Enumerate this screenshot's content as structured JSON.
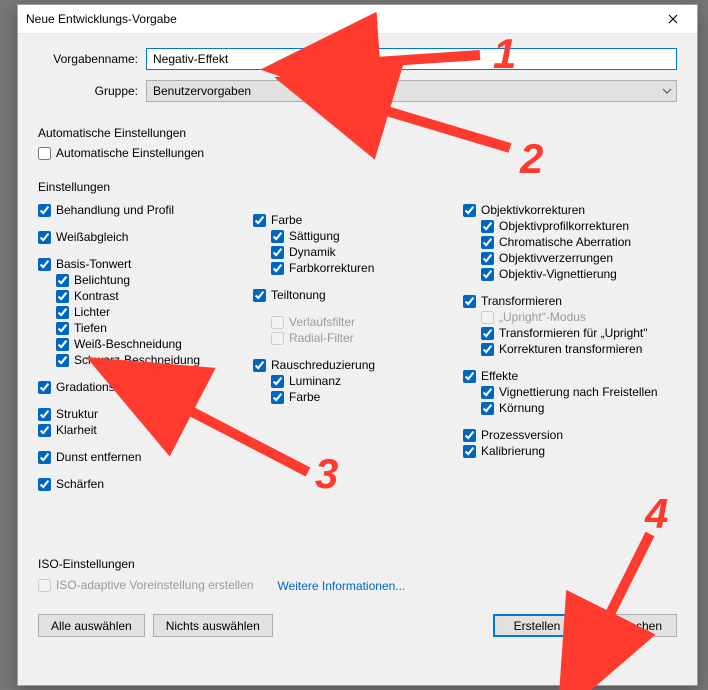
{
  "window": {
    "title": "Neue Entwicklungs-Vorgabe"
  },
  "form": {
    "name_label": "Vorgabenname:",
    "name_value": "Negativ-Effekt",
    "group_label": "Gruppe:",
    "group_value": "Benutzervorgaben"
  },
  "auto_settings": {
    "title": "Automatische Einstellungen",
    "label": "Automatische Einstellungen"
  },
  "settings_title": "Einstellungen",
  "col1": {
    "treat_profile": "Behandlung und Profil",
    "wb": "Weißabgleich",
    "base_tone": "Basis-Tonwert",
    "exposure": "Belichtung",
    "contrast": "Kontrast",
    "highlights": "Lichter",
    "shadows": "Tiefen",
    "whites": "Weiß-Beschneidung",
    "blacks": "Schwarz-Beschneidung",
    "tone_curve": "Gradationskurve",
    "structure": "Struktur",
    "clarity": "Klarheit",
    "dehaze": "Dunst entfernen",
    "sharpen": "Schärfen"
  },
  "col2": {
    "color": "Farbe",
    "saturation": "Sättigung",
    "dynamic": "Dynamik",
    "color_adjust": "Farbkorrekturen",
    "split_toning": "Teiltonung",
    "grad_filter": "Verlaufsfilter",
    "radial_filter": "Radial-Filter",
    "nr": "Rauschreduzierung",
    "nr_lum": "Luminanz",
    "nr_color": "Farbe"
  },
  "col3": {
    "lens": "Objektivkorrekturen",
    "lens_profile": "Objektivprofilkorrekturen",
    "lens_ca": "Chromatische Aberration",
    "lens_distort": "Objektivverzerrungen",
    "lens_vignette": "Objektiv-Vignettierung",
    "transform": "Transformieren",
    "upright_mode": "„Upright\"-Modus",
    "upright_trans": "Transformieren für „Upright\"",
    "trans_corr": "Korrekturen transformieren",
    "effects": "Effekte",
    "vignette": "Vignettierung nach Freistellen",
    "grain": "Körnung",
    "process": "Prozessversion",
    "calib": "Kalibrierung"
  },
  "iso": {
    "title": "ISO-Einstellungen",
    "cb": "ISO-adaptive Voreinstellung erstellen",
    "link": "Weitere Informationen..."
  },
  "buttons": {
    "all": "Alle auswählen",
    "none": "Nichts auswählen",
    "create": "Erstellen",
    "cancel": "Abbrechen"
  },
  "anno": {
    "n1": "1",
    "n2": "2",
    "n3": "3",
    "n4": "4"
  }
}
